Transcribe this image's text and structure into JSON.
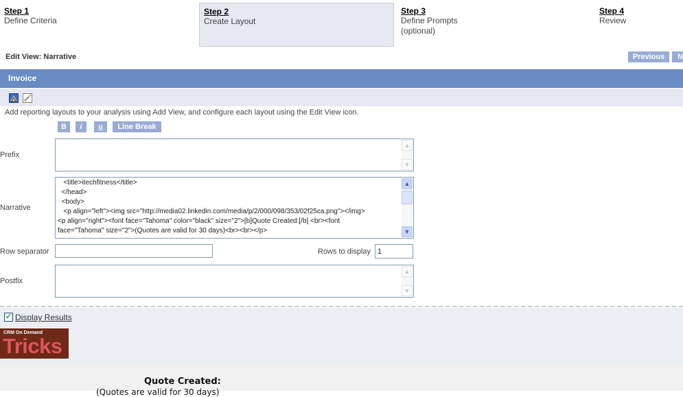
{
  "steps": [
    {
      "number": "Step 1",
      "description": "Define Criteria",
      "active": false
    },
    {
      "number": "Step 2",
      "description": "Create Layout",
      "active": true
    },
    {
      "number": "Step 3",
      "description": "Define Prompts",
      "description2": "(optional)",
      "active": false
    },
    {
      "number": "Step 4",
      "description": "Review",
      "active": false
    }
  ],
  "edit_view_title": "Edit View: Narrative",
  "nav": {
    "previous_label": "Previous",
    "next_label": "Next"
  },
  "section_title": "Invoice",
  "toolbar": {
    "icons": [
      "add-view-icon",
      "edit-view-icon"
    ]
  },
  "help_text": "Add reporting layouts to your analysis using Add View, and configure each layout using the Edit View icon.",
  "format_buttons": {
    "bold": "B",
    "italic": "i",
    "underline": "u",
    "line_break": "Line Break"
  },
  "fields": {
    "prefix_label": "Prefix",
    "prefix_value": "",
    "narrative_label": "Narrative",
    "narrative_value": "   <title>itechfitness</title>\n  </head>\n  <body>\n   <p align=\"left\"><img src=\"http://media02.linkedin.com/media/p/2/000/098/353/02f25ca.png\"></img>\n<p align=\"right\"><font face=\"Tahoma\" color=\"black\" size=\"2\">[b]Quote Created:[/b] <br><font\nface=\"Tahoma\" size=\"2\">(Quotes are valid for 30 days)<br><br></p>",
    "row_separator_label": "Row separator",
    "row_separator_value": "",
    "rows_to_display_label": "Rows to display",
    "rows_to_display_value": "1",
    "postfix_label": "Postfix",
    "postfix_value": ""
  },
  "display_results": {
    "label": "Display Results",
    "checked": true
  },
  "preview": {
    "logo_small": "CRM On Demand",
    "logo_big": "Tricks",
    "quote_created": "Quote Created:",
    "quote_validity": "(Quotes are valid for 30 days)"
  }
}
